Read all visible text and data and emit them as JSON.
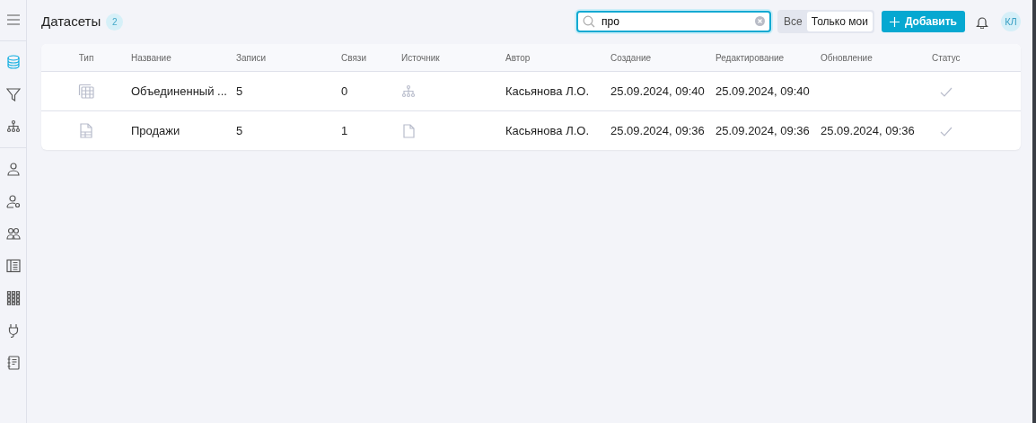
{
  "sidebar": {
    "items": [
      {
        "selected": false
      },
      {
        "selected": true
      },
      {
        "selected": false
      },
      {
        "selected": false
      },
      {
        "selected": false
      },
      {
        "selected": false
      },
      {
        "selected": false
      },
      {
        "selected": false
      },
      {
        "selected": false
      },
      {
        "selected": false
      },
      {
        "selected": false
      }
    ]
  },
  "header": {
    "title": "Датасеты",
    "count": "2",
    "search": {
      "value": "про"
    },
    "filters": [
      {
        "label": "Все",
        "selected": false
      },
      {
        "label": "Только мои",
        "selected": true
      }
    ],
    "add_button": "Добавить",
    "avatar": "КЛ"
  },
  "table": {
    "columns": [
      "Тип",
      "Название",
      "Записи",
      "Связи",
      "Источник",
      "Автор",
      "Создание",
      "Редактирование",
      "Обновление",
      "Статус"
    ],
    "rows": [
      {
        "name": "Объединенный ...",
        "records": "5",
        "links": "0",
        "author": "Касьянова Л.О.",
        "created": "25.09.2024, 09:40",
        "edited": "25.09.2024, 09:40",
        "done": true
      },
      {
        "name": "Продажи",
        "records": "5",
        "links": "1",
        "author": "Касьянова Л.О.",
        "created": "25.09.2024, 09:36",
        "edited": "25.09.2024, 09:36",
        "updated": "25.09.2024, 09:36",
        "done": true
      }
    ]
  }
}
